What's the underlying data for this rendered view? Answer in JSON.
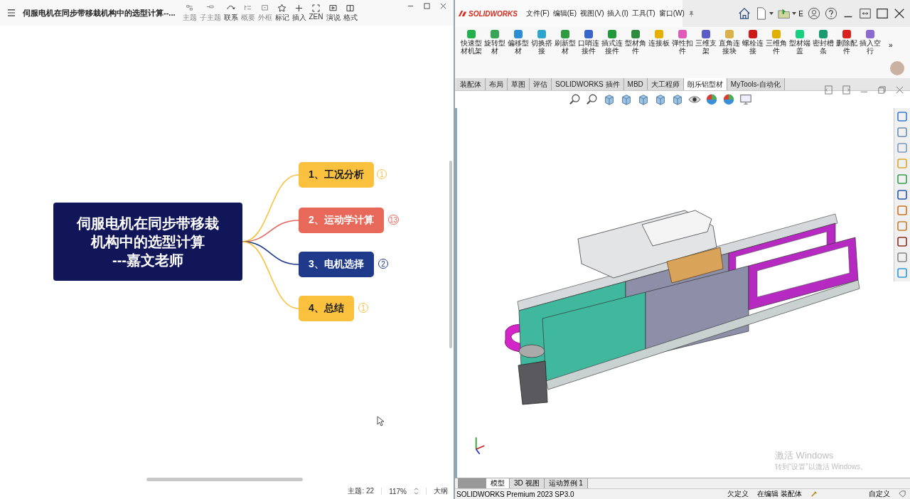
{
  "left_window": {
    "title": "伺服电机在同步带移栽机构中的选型计算--...",
    "toolbar": [
      {
        "label": "主题",
        "disabled": true
      },
      {
        "label": "子主题",
        "disabled": true
      },
      {
        "label": "联系",
        "disabled": false
      },
      {
        "label": "概要",
        "disabled": true
      },
      {
        "label": "外框",
        "disabled": true
      },
      {
        "label": "标记",
        "disabled": false
      },
      {
        "label": "插入",
        "disabled": false
      },
      {
        "label": "ZEN",
        "disabled": false
      },
      {
        "label": "演说",
        "disabled": false
      },
      {
        "label": "格式",
        "disabled": false
      }
    ],
    "mindmap": {
      "root_lines": [
        "伺服电机在同步带移栽",
        "机构中的选型计算",
        "---嘉文老师"
      ],
      "branches": [
        {
          "label": "1、工况分析",
          "color": "#f9c13d",
          "count": "1"
        },
        {
          "label": "2、运动学计算",
          "color": "#e8685a",
          "count": "13"
        },
        {
          "label": "3、电机选择",
          "color": "#1f3a8a",
          "count": "2"
        },
        {
          "label": "4、总结",
          "color": "#f9c13d",
          "count": "1"
        }
      ]
    },
    "status": {
      "topics": "主题: 22",
      "zoom": "117%",
      "outline": "大纲"
    }
  },
  "right_window": {
    "logo": "SOLIDWORKS",
    "menu": [
      "文件(F)",
      "编辑(E)",
      "视图(V)",
      "插入(I)",
      "工具(T)",
      "窗口(W)"
    ],
    "title_letter": "E",
    "commands": [
      {
        "label": "快速型材机架",
        "color": "#22b14c"
      },
      {
        "label": "旋转型材",
        "color": "#3aa655"
      },
      {
        "label": "偏移型材",
        "color": "#2b8fd6"
      },
      {
        "label": "切换搭接",
        "color": "#2fa6c9"
      },
      {
        "label": "刷新型材",
        "color": "#2e9b3e"
      },
      {
        "label": "口哨连接件",
        "color": "#3a64c8"
      },
      {
        "label": "插式连接件",
        "color": "#1f9a3a"
      },
      {
        "label": "型材角件",
        "color": "#2e8b3e"
      },
      {
        "label": "连接板",
        "color": "#e5b000"
      },
      {
        "label": "弹性扣件",
        "color": "#e05ab8"
      },
      {
        "label": "三维支架",
        "color": "#5a5ac8"
      },
      {
        "label": "直角连接块",
        "color": "#d8b24a"
      },
      {
        "label": "螺栓连接",
        "color": "#d01818"
      },
      {
        "label": "三维角件",
        "color": "#e0b000"
      },
      {
        "label": "型材端盖",
        "color": "#18d080"
      },
      {
        "label": "密封槽条",
        "color": "#1a9a70"
      },
      {
        "label": "删除配件",
        "color": "#d82020"
      },
      {
        "label": "插入空行",
        "color": "#8a6ad0"
      }
    ],
    "more": "»",
    "tabs": [
      {
        "label": "装配体",
        "selected": false
      },
      {
        "label": "布局",
        "selected": false
      },
      {
        "label": "草图",
        "selected": false
      },
      {
        "label": "评估",
        "selected": false
      },
      {
        "label": "SOLIDWORKS 插件",
        "selected": false
      },
      {
        "label": "MBD",
        "selected": false
      },
      {
        "label": "大工程师",
        "selected": false
      },
      {
        "label": "朗乐铝型材",
        "selected": true
      },
      {
        "label": "MyTools-自动化",
        "selected": false
      }
    ],
    "activation_notice": {
      "title": "激活 Windows",
      "hint": "转到“设置”以激活 Windows。"
    },
    "bottom_tabs": [
      {
        "label": "模型",
        "selected": true
      },
      {
        "label": "3D 视图",
        "selected": false
      },
      {
        "label": "运动算例 1",
        "selected": false
      }
    ],
    "status": {
      "product": "SOLIDWORKS Premium 2023 SP3.0",
      "definition": "欠定义",
      "editing": "在编辑 装配体",
      "custom": "自定义"
    }
  }
}
